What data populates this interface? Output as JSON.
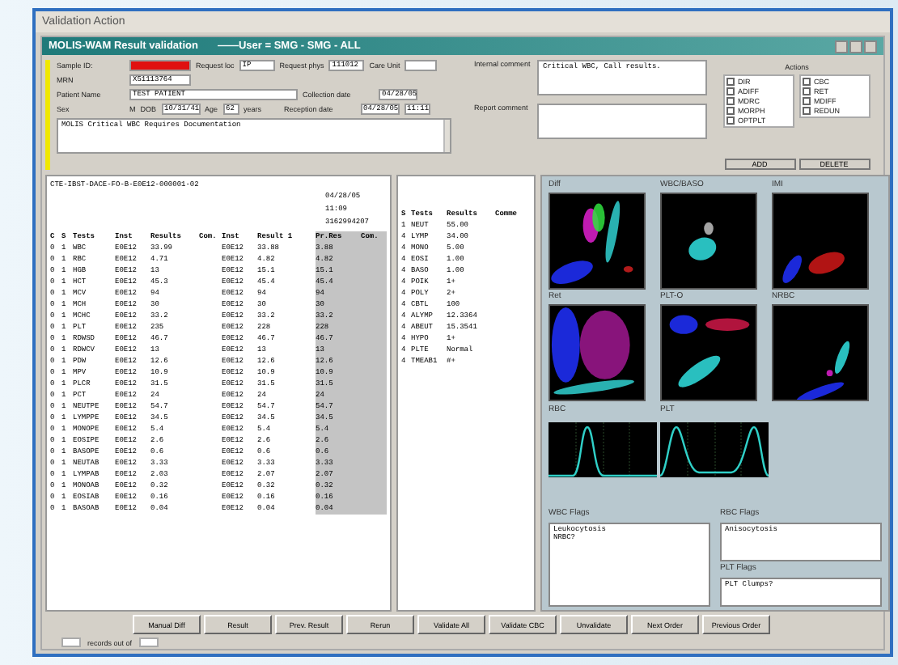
{
  "window": {
    "title": "Validation Action"
  },
  "app_window": {
    "title": "MOLIS-WAM  Result validation",
    "user": "——User = SMG - SMG - ALL"
  },
  "sample": {
    "sample_id": {
      "label": "Sample ID:",
      "flagged": true
    },
    "request_loc": {
      "label": "Request loc",
      "value": "IP"
    },
    "request_phys": {
      "label": "Request phys",
      "value": "111012"
    },
    "care_unit": {
      "label": "Care Unit"
    },
    "mrn": {
      "label": "MRN",
      "value": "X51113764"
    },
    "patient_name": {
      "label": "Patient Name",
      "value": "TEST PATIENT"
    },
    "sex": {
      "label": "Sex",
      "value": "M"
    },
    "dob": {
      "label": "DOB",
      "value": "10/31/41"
    },
    "age": {
      "label": "Age",
      "value": "62",
      "unit": "years"
    },
    "collection_date": {
      "label": "Collection date",
      "value": "04/28/05"
    },
    "reception_date": {
      "label": "Reception date",
      "value": "04/28/05",
      "time": "11:11"
    },
    "note": "MOLIS Critical WBC Requires Documentation"
  },
  "comments": {
    "internal_label": "Internal comment",
    "internal": "Critical WBC, Call results.",
    "report_label": "Report comment"
  },
  "actions": {
    "label": "Actions",
    "items": [
      {
        "label": "DIR",
        "checked": false
      },
      {
        "label": "ADIFF",
        "checked": false
      },
      {
        "label": "MDRC",
        "checked": false
      },
      {
        "label": "MORPH",
        "checked": false
      },
      {
        "label": "OPTPLT",
        "checked": false
      },
      {
        "label": "CBC",
        "checked": false
      },
      {
        "label": "RET",
        "checked": false
      },
      {
        "label": "MDIFF",
        "checked": false
      },
      {
        "label": "REDUN",
        "checked": false
      }
    ],
    "buttons": [
      "ADD",
      "DELETE"
    ]
  },
  "results": {
    "order": "CTE-IBST-DACE-FO-B-E0E12-000001-02",
    "date": "04/28/05",
    "time": "11:09",
    "number": "3162994207",
    "columns": [
      "C",
      "S",
      "Tests",
      "Inst",
      "Results",
      "Com.",
      "Inst",
      "Result 1",
      "Pr.Res",
      "Com."
    ],
    "rows": [
      [
        "0",
        "1",
        "WBC",
        "E0E12",
        "33.99",
        "",
        "E0E12",
        "33.88",
        "3.88",
        ""
      ],
      [
        "0",
        "1",
        "RBC",
        "E0E12",
        "4.71",
        "",
        "E0E12",
        "4.82",
        "4.82",
        ""
      ],
      [
        "0",
        "1",
        "HGB",
        "E0E12",
        "13",
        "",
        "E0E12",
        "15.1",
        "15.1",
        ""
      ],
      [
        "0",
        "1",
        "HCT",
        "E0E12",
        "45.3",
        "",
        "E0E12",
        "45.4",
        "45.4",
        ""
      ],
      [
        "0",
        "1",
        "MCV",
        "E0E12",
        "94",
        "",
        "E0E12",
        "94",
        "94",
        ""
      ],
      [
        "0",
        "1",
        "MCH",
        "E0E12",
        "30",
        "",
        "E0E12",
        "30",
        "30",
        ""
      ],
      [
        "0",
        "1",
        "MCHC",
        "E0E12",
        "33.2",
        "",
        "E0E12",
        "33.2",
        "33.2",
        ""
      ],
      [
        "0",
        "1",
        "PLT",
        "E0E12",
        "235",
        "",
        "E0E12",
        "228",
        "228",
        ""
      ],
      [
        "0",
        "1",
        "RDWSD",
        "E0E12",
        "46.7",
        "",
        "E0E12",
        "46.7",
        "46.7",
        ""
      ],
      [
        "0",
        "1",
        "RDWCV",
        "E0E12",
        "13",
        "",
        "E0E12",
        "13",
        "13",
        ""
      ],
      [
        "0",
        "1",
        "PDW",
        "E0E12",
        "12.6",
        "",
        "E0E12",
        "12.6",
        "12.6",
        ""
      ],
      [
        "0",
        "1",
        "MPV",
        "E0E12",
        "10.9",
        "",
        "E0E12",
        "10.9",
        "10.9",
        ""
      ],
      [
        "0",
        "1",
        "PLCR",
        "E0E12",
        "31.5",
        "",
        "E0E12",
        "31.5",
        "31.5",
        ""
      ],
      [
        "0",
        "1",
        "PCT",
        "E0E12",
        "24",
        "",
        "E0E12",
        "24",
        "24",
        ""
      ],
      [
        "0",
        "1",
        "NEUTPE",
        "E0E12",
        "54.7",
        "",
        "E0E12",
        "54.7",
        "54.7",
        ""
      ],
      [
        "0",
        "1",
        "LYMPPE",
        "E0E12",
        "34.5",
        "",
        "E0E12",
        "34.5",
        "34.5",
        ""
      ],
      [
        "0",
        "1",
        "MONOPE",
        "E0E12",
        "5.4",
        "",
        "E0E12",
        "5.4",
        "5.4",
        ""
      ],
      [
        "0",
        "1",
        "EOSIPE",
        "E0E12",
        "2.6",
        "",
        "E0E12",
        "2.6",
        "2.6",
        ""
      ],
      [
        "0",
        "1",
        "BASOPE",
        "E0E12",
        "0.6",
        "",
        "E0E12",
        "0.6",
        "0.6",
        ""
      ],
      [
        "0",
        "1",
        "NEUTAB",
        "E0E12",
        "3.33",
        "",
        "E0E12",
        "3.33",
        "3.33",
        ""
      ],
      [
        "0",
        "1",
        "LYMPAB",
        "E0E12",
        "2.03",
        "",
        "E0E12",
        "2.07",
        "2.07",
        ""
      ],
      [
        "0",
        "1",
        "MONOAB",
        "E0E12",
        "0.32",
        "",
        "E0E12",
        "0.32",
        "0.32",
        ""
      ],
      [
        "0",
        "1",
        "EOSIAB",
        "E0E12",
        "0.16",
        "",
        "E0E12",
        "0.16",
        "0.16",
        ""
      ],
      [
        "0",
        "1",
        "BASOAB",
        "E0E12",
        "0.04",
        "",
        "E0E12",
        "0.04",
        "0.04",
        ""
      ]
    ]
  },
  "manual": {
    "columns": [
      "S",
      "Tests",
      "Results",
      "Comme"
    ],
    "rows": [
      [
        "1",
        "NEUT",
        "55.00"
      ],
      [
        "4",
        "LYMP",
        "34.00"
      ],
      [
        "4",
        "MONO",
        "5.00"
      ],
      [
        "4",
        "EOSI",
        "1.00"
      ],
      [
        "4",
        "BASO",
        "1.00"
      ],
      [
        "4",
        "POIK",
        "1+"
      ],
      [
        "4",
        "POLY",
        "2+"
      ],
      [
        "4",
        "CBTL",
        "100"
      ],
      [
        "4",
        "ALYMP",
        "12.3364"
      ],
      [
        "4",
        "ABEUT",
        "15.3541"
      ],
      [
        "4",
        "HYPO",
        "1+"
      ],
      [
        "4",
        "PLTE",
        "Normal"
      ],
      [
        "4",
        "TMEAB1",
        "#+"
      ]
    ]
  },
  "scatter_plots": [
    {
      "label": "Diff"
    },
    {
      "label": "WBC/BASO"
    },
    {
      "label": "IMI"
    },
    {
      "label": "Ret"
    },
    {
      "label": "PLT-O"
    },
    {
      "label": "NRBC"
    }
  ],
  "histograms": [
    {
      "label": "RBC"
    },
    {
      "label": "PLT"
    }
  ],
  "flags": {
    "wbc_label": "WBC Flags",
    "wbc": [
      "Leukocytosis",
      "NRBC?"
    ],
    "rbc_label": "RBC Flags",
    "rbc": [
      "Anisocytosis"
    ],
    "plt_label": "PLT Flags",
    "plt": [
      "PLT Clumps?"
    ]
  },
  "buttons": [
    "Manual Diff",
    "Result",
    "Prev. Result",
    "Rerun",
    "Validate All",
    "Validate CBC",
    "Unvalidate",
    "Next Order",
    "Previous Order"
  ],
  "status": "records out of"
}
